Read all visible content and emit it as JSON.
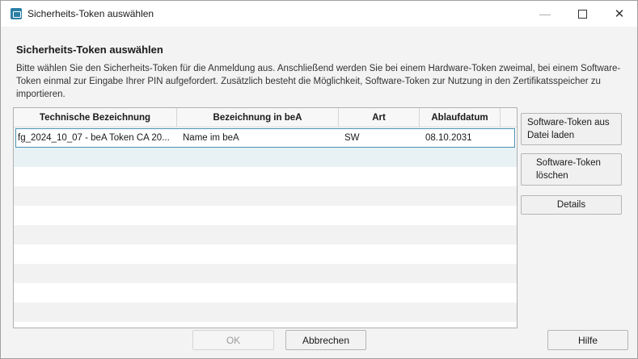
{
  "window": {
    "title": "Sicherheits-Token auswählen",
    "controls": {
      "minimize": "—",
      "close": "✕"
    }
  },
  "dialog": {
    "heading": "Sicherheits-Token auswählen",
    "description": "Bitte wählen Sie den Sicherheits-Token für die Anmeldung aus. Anschließend werden Sie bei einem Hardware-Token zweimal, bei einem Software-Token einmal zur Eingabe Ihrer PIN aufgefordert. Zusätzlich besteht die Möglichkeit, Software-Token zur Nutzung in den Zertifikatsspeicher zu importieren."
  },
  "table": {
    "columns": [
      "Technische Bezeichnung",
      "Bezeichnung in beA",
      "Art",
      "Ablaufdatum"
    ],
    "rows": [
      {
        "technical": "fg_2024_10_07 - beA Token CA 20...",
        "name": "Name im beA",
        "type": "SW",
        "expiry": "08.10.2031"
      }
    ]
  },
  "side_buttons": {
    "load_line1": "Software-Token aus",
    "load_line2": "Datei laden",
    "delete_line1": "Software-Token",
    "delete_line2": "löschen",
    "details": "Details"
  },
  "bottom_buttons": {
    "ok": "OK",
    "cancel": "Abbrechen",
    "help": "Hilfe"
  }
}
